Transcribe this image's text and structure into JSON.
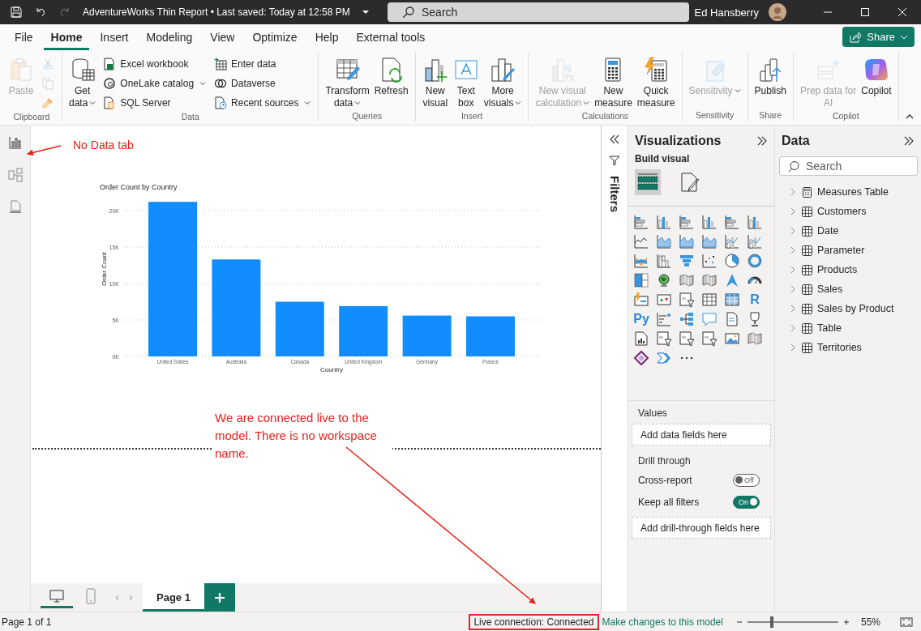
{
  "title_bar": {
    "title": "AdventureWorks Thin Report • Last saved: Today at 12:58 PM",
    "search_placeholder": "Search",
    "user": "Ed Hansberry"
  },
  "menu_tabs": [
    {
      "label": "File",
      "selected": false
    },
    {
      "label": "Home",
      "selected": true
    },
    {
      "label": "Insert",
      "selected": false
    },
    {
      "label": "Modeling",
      "selected": false
    },
    {
      "label": "View",
      "selected": false
    },
    {
      "label": "Optimize",
      "selected": false
    },
    {
      "label": "Help",
      "selected": false
    },
    {
      "label": "External tools",
      "selected": false
    }
  ],
  "share_button": "Share",
  "ribbon": {
    "groups": [
      {
        "label": "Clipboard",
        "columns": [
          [
            {
              "kind": "large",
              "label": "Paste",
              "disabled": true,
              "dropdown": false
            }
          ],
          [
            {
              "kind": "icon",
              "disabled": true
            },
            {
              "kind": "icon",
              "disabled": true
            },
            {
              "kind": "icon",
              "disabled": false
            }
          ]
        ]
      },
      {
        "label": "Data",
        "columns": [
          [
            {
              "kind": "large",
              "label": "Get\ndata",
              "disabled": false,
              "dropdown": true
            }
          ],
          [
            {
              "kind": "small",
              "label": "Excel workbook",
              "disabled": false,
              "dropdown": false
            },
            {
              "kind": "small",
              "label": "OneLake catalog",
              "disabled": false,
              "dropdown": true
            },
            {
              "kind": "small",
              "label": "SQL Server",
              "disabled": false,
              "dropdown": false
            }
          ],
          [
            {
              "kind": "small",
              "label": "Enter data",
              "disabled": false,
              "dropdown": false
            },
            {
              "kind": "small",
              "label": "Dataverse",
              "disabled": false,
              "dropdown": false
            },
            {
              "kind": "small",
              "label": "Recent sources",
              "disabled": false,
              "dropdown": true
            }
          ]
        ]
      },
      {
        "label": "Queries",
        "columns": [
          [
            {
              "kind": "large",
              "label": "Transform\ndata",
              "disabled": false,
              "dropdown": true
            },
            {
              "kind": "large",
              "label": "Refresh",
              "disabled": false,
              "dropdown": false
            }
          ]
        ]
      },
      {
        "label": "Insert",
        "columns": [
          [
            {
              "kind": "large",
              "label": "New\nvisual",
              "disabled": false,
              "dropdown": false
            },
            {
              "kind": "large",
              "label": "Text\nbox",
              "disabled": false,
              "dropdown": false
            },
            {
              "kind": "large",
              "label": "More\nvisuals",
              "disabled": false,
              "dropdown": true
            }
          ]
        ]
      },
      {
        "label": "Calculations",
        "columns": [
          [
            {
              "kind": "large",
              "label": "New visual\ncalculation",
              "disabled": true,
              "dropdown": true
            },
            {
              "kind": "large",
              "label": "New\nmeasure",
              "disabled": false,
              "dropdown": false
            },
            {
              "kind": "large",
              "label": "Quick\nmeasure",
              "disabled": false,
              "dropdown": false
            }
          ]
        ]
      },
      {
        "label": "Sensitivity",
        "columns": [
          [
            {
              "kind": "large",
              "label": "Sensitivity",
              "disabled": true,
              "dropdown": true
            }
          ]
        ]
      },
      {
        "label": "Share",
        "columns": [
          [
            {
              "kind": "large",
              "label": "Publish",
              "disabled": false,
              "dropdown": false
            }
          ]
        ]
      },
      {
        "label": "Copilot",
        "columns": [
          [
            {
              "kind": "large",
              "label": "Prep data for\nAI",
              "disabled": true,
              "dropdown": false
            },
            {
              "kind": "large",
              "label": "Copilot",
              "disabled": false,
              "dropdown": false
            }
          ]
        ]
      }
    ]
  },
  "canvas": {
    "chart_data": {
      "type": "bar",
      "title": "Order Count by Country",
      "xlabel": "Country",
      "ylabel": "Order Count",
      "categories": [
        "United States",
        "Australia",
        "Canada",
        "United Kingdom",
        "Germany",
        "France"
      ],
      "values": [
        21200,
        13300,
        7500,
        6900,
        5600,
        5500
      ],
      "ylim": [
        0,
        21500
      ],
      "grid": true,
      "yticks": [
        {
          "value": 0,
          "label": "0K"
        },
        {
          "value": 5000,
          "label": "5K"
        },
        {
          "value": 10000,
          "label": "10K"
        },
        {
          "value": 15000,
          "label": "15K"
        },
        {
          "value": 20000,
          "label": "20K"
        }
      ]
    }
  },
  "annotations": [
    {
      "text": "No Data tab"
    },
    {
      "text": "We are connected live to the model. There is no workspace name."
    }
  ],
  "page_views": [
    {
      "kind": "desktop",
      "selected": true
    },
    {
      "kind": "phone",
      "selected": false
    }
  ],
  "pages": [
    {
      "label": "Page 1",
      "selected": true
    }
  ],
  "filters": {
    "label": "Filters"
  },
  "visualizations": {
    "title": "Visualizations",
    "subtitle": "Build visual",
    "build_tabs": [
      {
        "kind": "build",
        "selected": true
      },
      {
        "kind": "format",
        "selected": false
      }
    ],
    "glyphs": [
      "R",
      "Py"
    ],
    "values_label": "Values",
    "values_well": "Add data fields here",
    "drill_label": "Drill through",
    "toggles": [
      {
        "label": "Cross-report",
        "on": false,
        "state": "Off"
      },
      {
        "label": "Keep all filters",
        "on": true,
        "state": "On"
      }
    ],
    "drill_well": "Add drill-through fields here"
  },
  "data_pane": {
    "title": "Data",
    "search_placeholder": "Search",
    "tables": [
      {
        "name": "Measures Table",
        "kind": "measures",
        "expanded": false
      },
      {
        "name": "Customers",
        "kind": "table",
        "expanded": false
      },
      {
        "name": "Date",
        "kind": "table",
        "expanded": false
      },
      {
        "name": "Parameter",
        "kind": "table",
        "expanded": false
      },
      {
        "name": "Products",
        "kind": "table",
        "expanded": false
      },
      {
        "name": "Sales",
        "kind": "table",
        "expanded": false
      },
      {
        "name": "Sales by Product",
        "kind": "table",
        "expanded": false
      },
      {
        "name": "Table",
        "kind": "table",
        "expanded": false
      },
      {
        "name": "Territories",
        "kind": "table",
        "expanded": false
      }
    ]
  },
  "status_bar": {
    "page": "Page 1 of 1",
    "connection": "Live connection: Connected",
    "link": "Make changes to this model",
    "zoom_slider": {
      "level": 0.27
    },
    "zoom": "55%"
  }
}
